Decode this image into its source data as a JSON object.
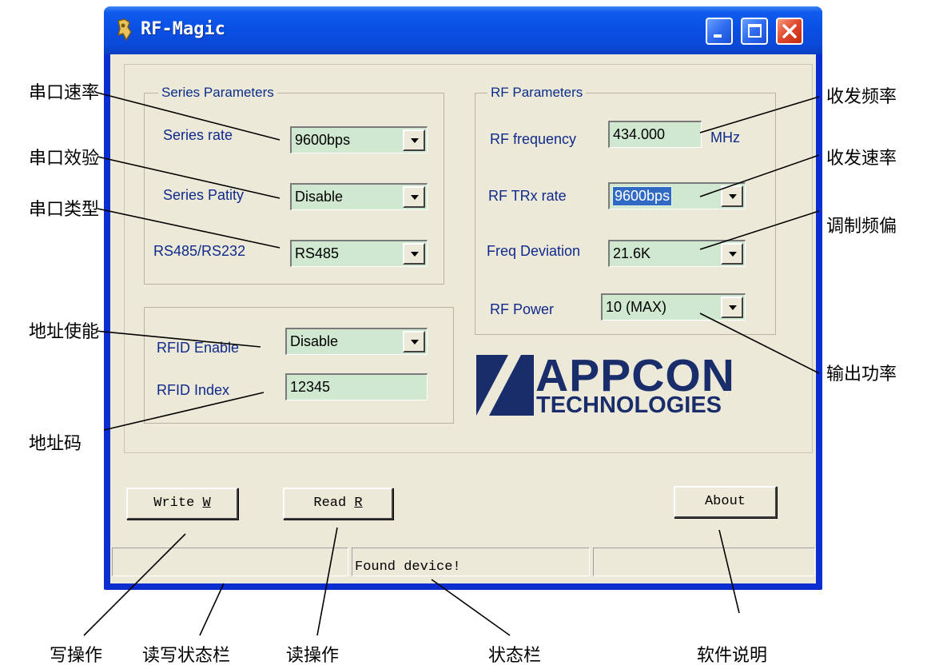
{
  "window": {
    "title": "RF-Magic",
    "caption_buttons": [
      "minimize-icon",
      "maximize-icon",
      "close-icon"
    ]
  },
  "series_group": {
    "title": "Series Parameters",
    "rate_label": "Series rate",
    "rate_value": "9600bps",
    "parity_label": "Series Patity",
    "parity_value": "Disable",
    "type_label": "RS485/RS232",
    "type_value": "RS485"
  },
  "rfid_group": {
    "enable_label": "RFID Enable",
    "enable_value": "Disable",
    "index_label": "RFID Index",
    "index_value": "12345"
  },
  "rf_group": {
    "title": "RF Parameters",
    "frequency_label": "RF frequency",
    "frequency_value": "434.000",
    "frequency_unit": "MHz",
    "trx_rate_label": "RF TRx rate",
    "trx_rate_value": "9600bps",
    "deviation_label": "Freq  Deviation",
    "deviation_value": "21.6K",
    "power_label": "RF Power",
    "power_value": "10 (MAX)"
  },
  "logo": {
    "line1": "APPCON",
    "line2": "TECHNOLOGIES"
  },
  "buttons": {
    "write": "Write ",
    "write_key": "W",
    "read": "Read ",
    "read_key": "R",
    "about": "About"
  },
  "status_bar": {
    "left": "",
    "center": "Found device!",
    "right": ""
  },
  "annotations": {
    "series_rate": "串口速率",
    "series_parity": "串口效验",
    "series_type": "串口类型",
    "rfid_enable": "地址使能",
    "rfid_index": "地址码",
    "rf_frequency": "收发频率",
    "rf_trx_rate": "收发速率",
    "freq_deviation": "调制频偏",
    "rf_power": "输出功率",
    "write_op": "写操作",
    "rw_status": "读写状态栏",
    "read_op": "读操作",
    "status_bar": "状态栏",
    "about": "软件说明"
  },
  "colors": {
    "titlebar": "#0a50e6",
    "client_bg": "#ece9d8",
    "field_bg": "#cfe8cf",
    "label_text": "#102a8c",
    "selection": "#316ac5",
    "logo": "#1a2d6b"
  }
}
